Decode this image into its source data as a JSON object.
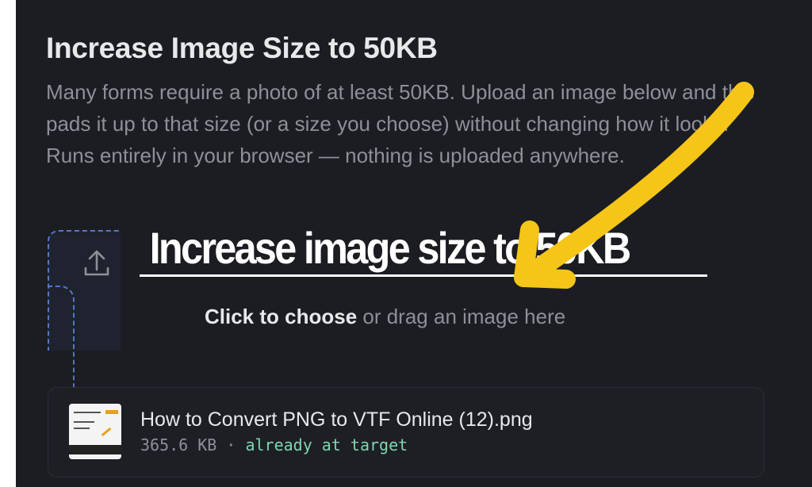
{
  "page": {
    "title": "Increase Image Size to 50KB",
    "description": "Many forms require a photo of at least 50KB. Upload an image below and this pads it up to that size (or a size you choose) without changing how it looks. Runs entirely in your browser — nothing is uploaded anywhere."
  },
  "dropzone": {
    "icon": "upload-icon",
    "action_label": "Click to choose",
    "hint_text": " or drag an image here"
  },
  "overlay": {
    "caption": "Increase image size to 50KB",
    "arrow_icon": "arrow-icon",
    "arrow_color": "#f5c518"
  },
  "file": {
    "name": "How to Convert PNG to VTF Online (12).png",
    "size": "365.6 KB",
    "separator": " · ",
    "status": "already at target"
  },
  "colors": {
    "background": "#1c1d22",
    "accent_dashed": "#5277c9",
    "status_green": "#7fd6b0"
  }
}
